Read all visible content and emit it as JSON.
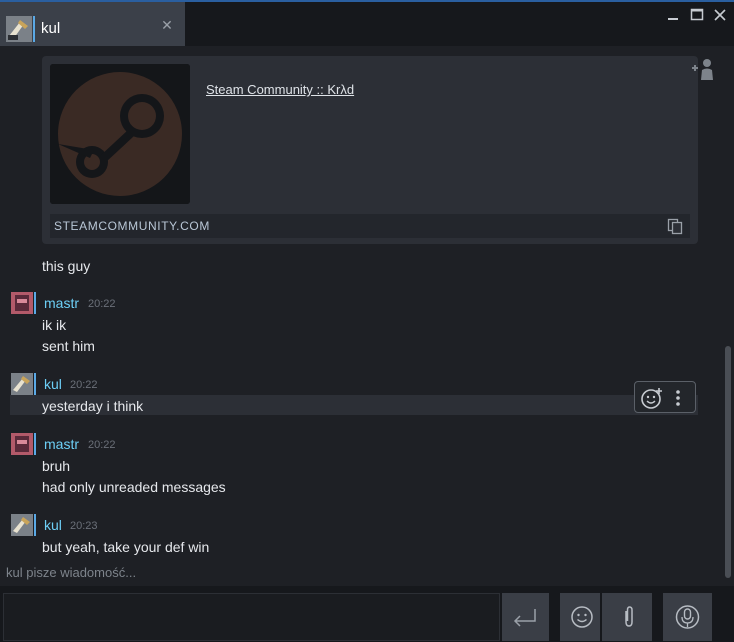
{
  "tab": {
    "title": "kul"
  },
  "embed": {
    "title": "Steam Community :: Krλd",
    "domain": "STEAMCOMMUNITY.COM"
  },
  "messages": [
    {
      "text": "this guy"
    },
    {
      "author": "mastr",
      "time": "20:22",
      "lines": [
        "ik ik",
        "sent him"
      ]
    },
    {
      "author": "kul",
      "time": "20:22",
      "lines": [
        "yesterday i think"
      ]
    },
    {
      "author": "mastr",
      "time": "20:22",
      "lines": [
        "bruh",
        "had only unreaded messages"
      ]
    },
    {
      "author": "kul",
      "time": "20:23",
      "lines": [
        "but yeah, take your def win"
      ]
    }
  ],
  "typing": "kul pisze wiadomość...",
  "composer": {
    "value": "",
    "placeholder": ""
  },
  "colors": {
    "accent": "#6dcff6",
    "mastr_line": "#5aa9e6",
    "kul_line": "#5aa9e6",
    "background": "#1e2025"
  }
}
